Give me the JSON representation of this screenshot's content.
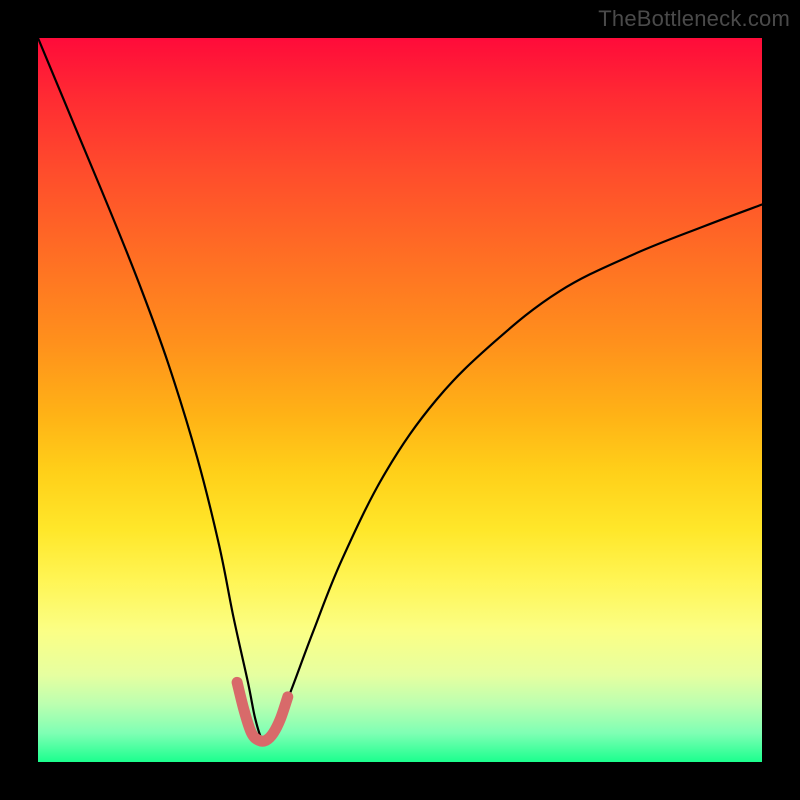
{
  "attribution": "TheBottleneck.com",
  "chart_data": {
    "type": "line",
    "title": "",
    "xlabel": "",
    "ylabel": "",
    "xlim": [
      0,
      100
    ],
    "ylim": [
      0,
      100
    ],
    "grid": false,
    "legend": false,
    "series": [
      {
        "name": "bottleneck-curve",
        "color": "#000000",
        "width": 2.2,
        "x": [
          0,
          5,
          10,
          14,
          18,
          22,
          25,
          27,
          29,
          30,
          31,
          32,
          33,
          35,
          38,
          42,
          48,
          55,
          63,
          72,
          82,
          92,
          100
        ],
        "y": [
          100,
          88,
          76,
          66,
          55,
          42,
          30,
          20,
          11,
          6,
          3,
          3,
          5,
          10,
          18,
          28,
          40,
          50,
          58,
          65,
          70,
          74,
          77
        ]
      },
      {
        "name": "valley-marker",
        "color": "#d86a6a",
        "width": 11,
        "x": [
          27.5,
          28.5,
          29.5,
          30.5,
          31.5,
          32.5,
          33.5,
          34.5
        ],
        "y": [
          11,
          7,
          4,
          3,
          3,
          4,
          6,
          9
        ]
      }
    ],
    "annotations": []
  }
}
